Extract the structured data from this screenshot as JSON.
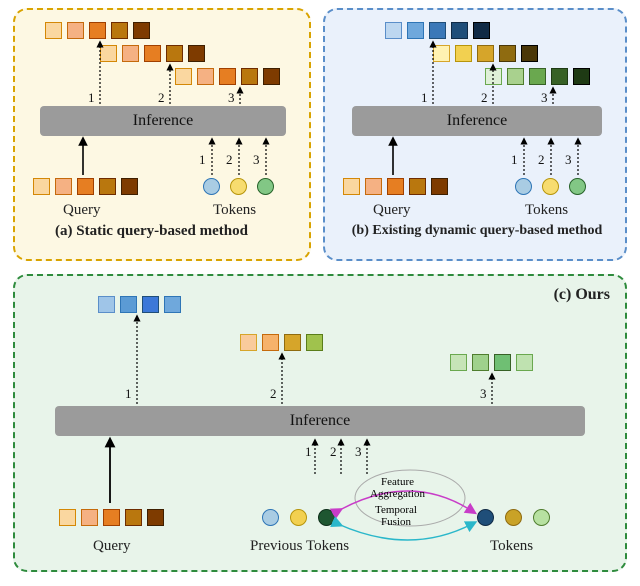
{
  "panelA": {
    "caption": "(a) Static query-based method",
    "inference": "Inference",
    "queryLabel": "Query",
    "tokensLabel": "Tokens",
    "ts": [
      "1",
      "2",
      "3"
    ],
    "queryColors": [
      "#fad7a0",
      "#f5b183",
      "#e67e22",
      "#b9770e",
      "#7e3b00"
    ],
    "tokenColors": [
      "#a9cce3",
      "#f7dc6f",
      "#82c785"
    ]
  },
  "panelB": {
    "caption": "(b) Existing dynamic query-based method",
    "inference": "Inference",
    "queryLabel": "Query",
    "tokensLabel": "Tokens",
    "ts": [
      "1",
      "2",
      "3"
    ],
    "queryColors": [
      "#fad7a0",
      "#f5b183",
      "#e67e22",
      "#b9770e",
      "#7e3b00"
    ],
    "row1": [
      "#bdd7f0",
      "#6fa8dc",
      "#3b78b8",
      "#1f4e79",
      "#102a45"
    ],
    "row2": [
      "#fff2b2",
      "#f2d050",
      "#d6a52a",
      "#8f6b10",
      "#4a3708"
    ],
    "row3": [
      "#dff0d8",
      "#a9d18e",
      "#6aa84f",
      "#376126",
      "#1e3a14"
    ],
    "tokenColors": [
      "#a9cce3",
      "#f7dc6f",
      "#82c785"
    ]
  },
  "panelC": {
    "caption": "(c) Ours",
    "inference": "Inference",
    "queryLabel": "Query",
    "prevLabel": "Previous Tokens",
    "tokensLabel": "Tokens",
    "feat": "Feature\nAggregation",
    "temp": "Temporal\nFusion",
    "ts": [
      "1",
      "2",
      "3"
    ],
    "queryColors": [
      "#fad7a0",
      "#f5b183",
      "#e67e22",
      "#b9770e",
      "#7e3b00"
    ],
    "out1": [
      "#9fc5e8",
      "#5b9bd5",
      "#3c78d8",
      "#6fa8dc"
    ],
    "out2": [
      "#f9cb9c",
      "#f6b26b",
      "#d6a52a",
      "#a0c24d"
    ],
    "out3": [
      "#c6e4b7",
      "#9fd18c",
      "#6fbf73",
      "#bfe2b0"
    ],
    "prevTokens": [
      "#a9cce3",
      "#f2d050",
      "#1e5631"
    ],
    "tokens": [
      "#1f4e79",
      "#c9a227",
      "#b7e1a1"
    ]
  }
}
